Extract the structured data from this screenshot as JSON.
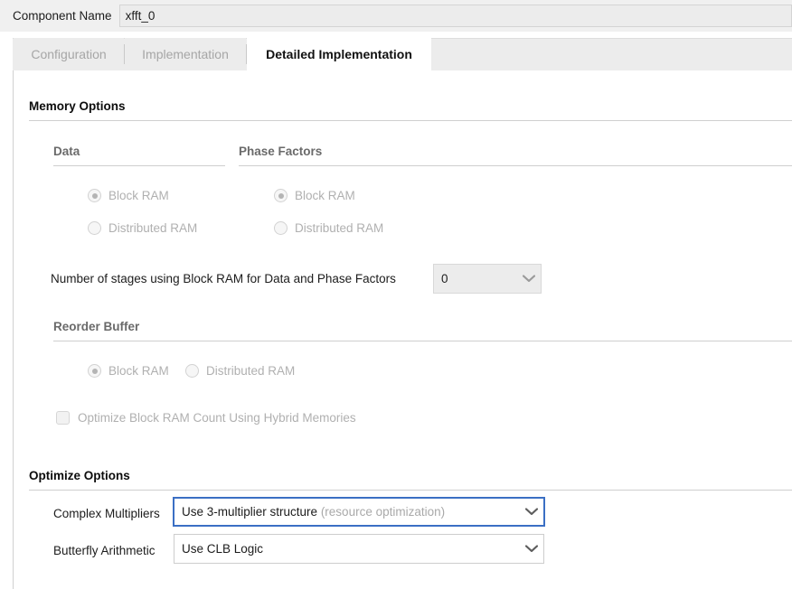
{
  "component": {
    "label": "Component Name",
    "value": "xfft_0",
    "placeholder": ""
  },
  "tabs": [
    {
      "label": "Configuration",
      "active": false
    },
    {
      "label": "Implementation",
      "active": false
    },
    {
      "label": "Detailed Implementation",
      "active": true
    }
  ],
  "memory_options": {
    "title": "Memory Options",
    "data_group": {
      "title": "Data",
      "options": [
        {
          "label": "Block RAM",
          "selected": true
        },
        {
          "label": "Distributed RAM",
          "selected": false
        }
      ]
    },
    "phase_factors_group": {
      "title": "Phase Factors",
      "options": [
        {
          "label": "Block RAM",
          "selected": true
        },
        {
          "label": "Distributed RAM",
          "selected": false
        }
      ]
    },
    "stages": {
      "label": "Number of stages using Block RAM for Data and Phase Factors",
      "value": "0"
    },
    "reorder_buffer": {
      "title": "Reorder Buffer",
      "options": [
        {
          "label": "Block RAM",
          "selected": true
        },
        {
          "label": "Distributed RAM",
          "selected": false
        }
      ],
      "optimize_checkbox": {
        "label": "Optimize Block RAM Count Using Hybrid Memories",
        "checked": false
      }
    }
  },
  "optimize_options": {
    "title": "Optimize Options",
    "complex_multipliers": {
      "label": "Complex Multipliers",
      "value": "Use 3-multiplier structure",
      "value_suffix": "(resource optimization)"
    },
    "butterfly_arithmetic": {
      "label": "Butterfly Arithmetic",
      "value": "Use CLB Logic"
    }
  },
  "colors": {
    "focus_border": "#3b6fc4",
    "disabled_text": "#b0b0b0",
    "header_bar": "#f0f0f0",
    "tab_strip": "#ececec"
  },
  "icons": {
    "chevron": "chevron-down-icon"
  }
}
